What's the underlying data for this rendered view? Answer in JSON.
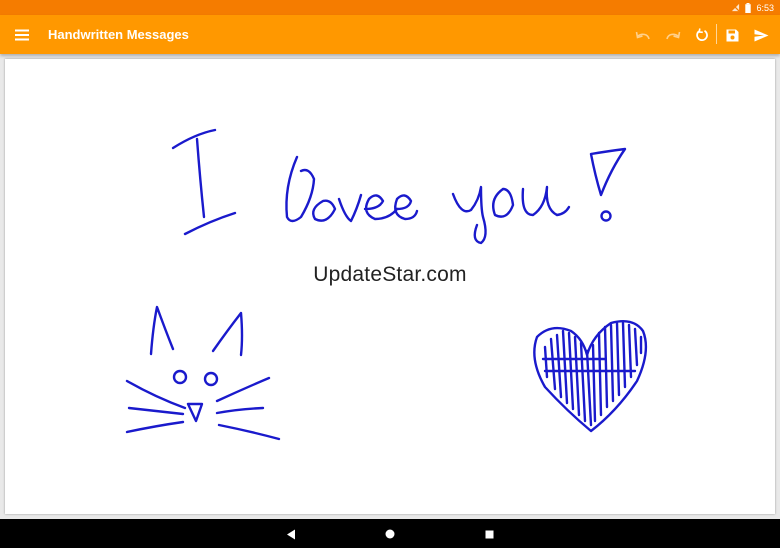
{
  "status_bar": {
    "time": "6:53",
    "icons": [
      "no-sim-icon",
      "battery-icon"
    ]
  },
  "app_bar": {
    "title": "Handwritten Messages",
    "actions": [
      "menu-icon",
      "undo-icon",
      "redo-icon",
      "reset-icon",
      "save-icon",
      "send-icon"
    ]
  },
  "canvas": {
    "ink_color": "#1a1acc",
    "drawings": [
      "I love you!",
      "cat-face",
      "heart"
    ],
    "watermark": "UpdateStar.com"
  },
  "nav_bar": {
    "icons": [
      "back-icon",
      "home-icon",
      "recents-icon"
    ]
  },
  "colors": {
    "status_bar": "#f57c00",
    "app_bar": "#ff9800",
    "ink": "#1a1acc"
  }
}
